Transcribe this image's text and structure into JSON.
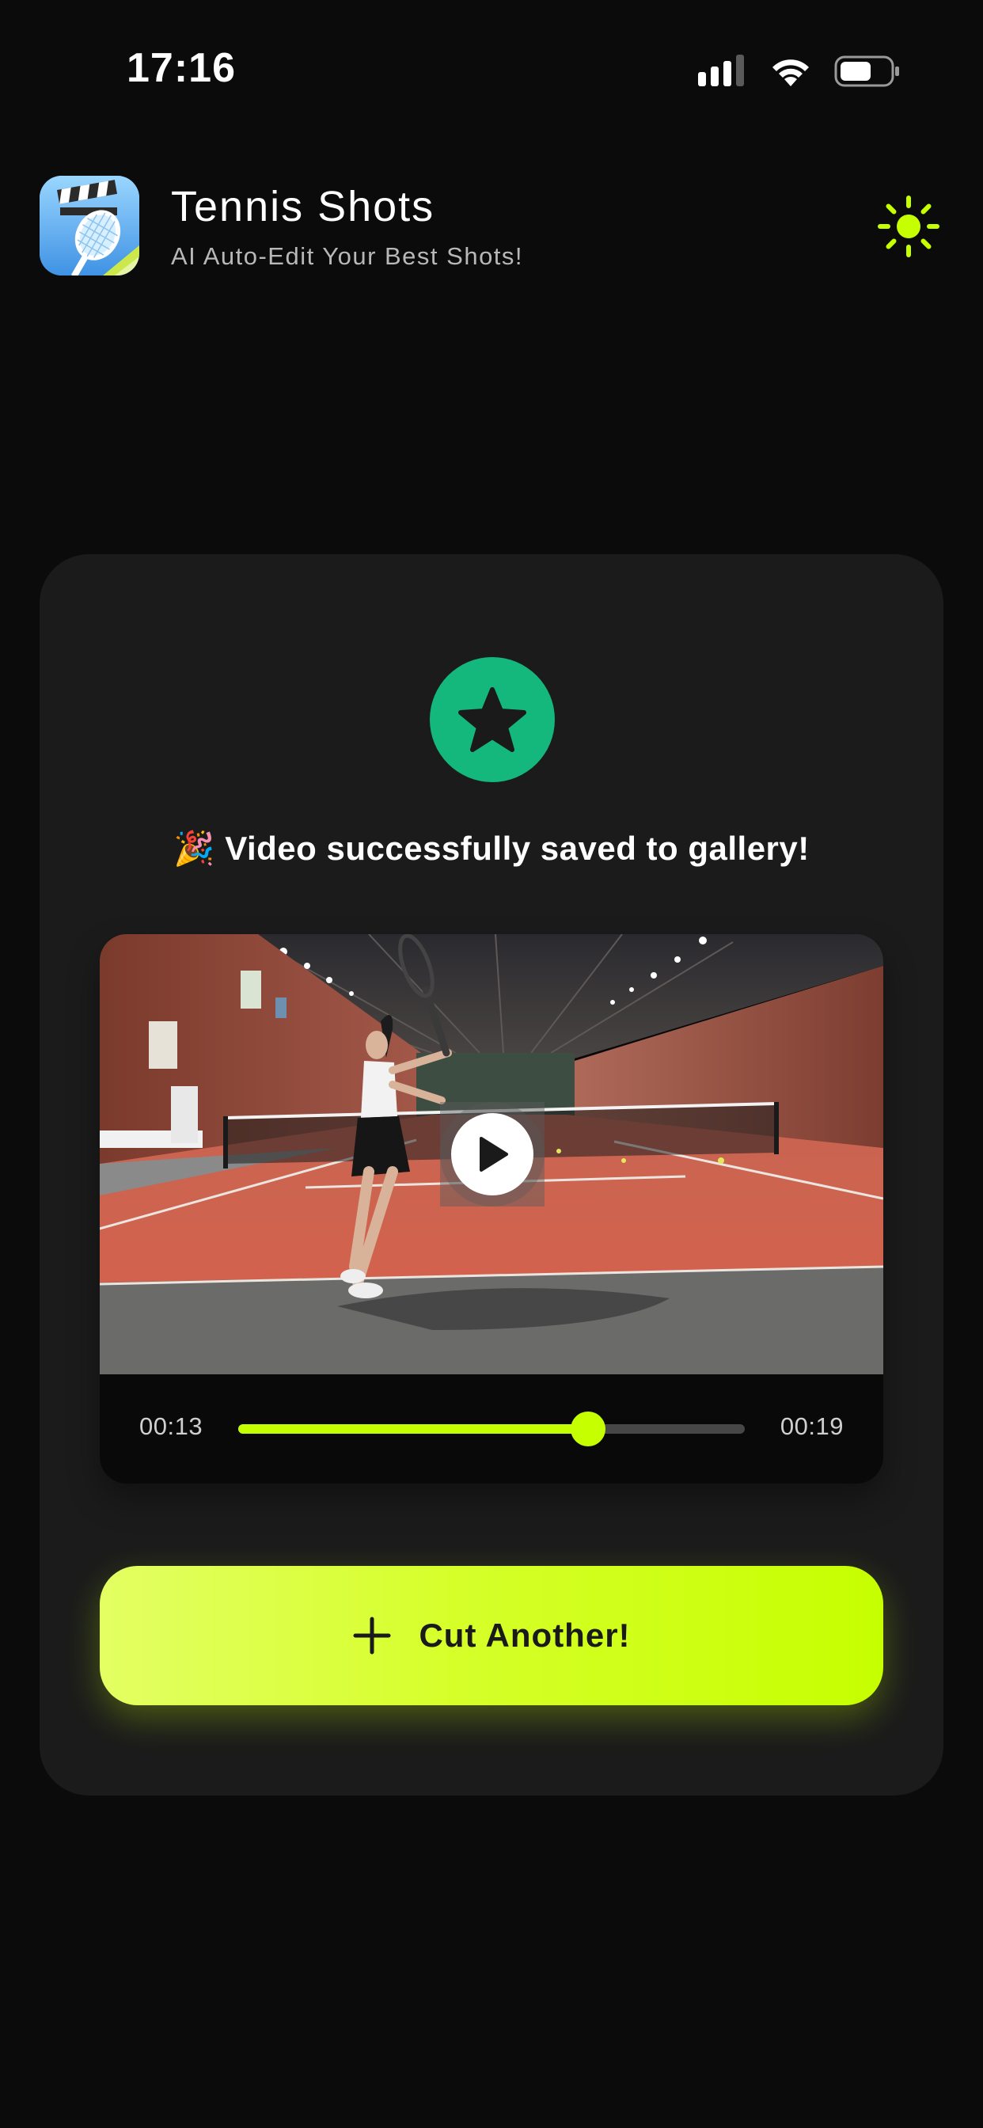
{
  "status_bar": {
    "time": "17:16",
    "icons": [
      "cellular-signal-icon",
      "wifi-icon",
      "battery-icon"
    ]
  },
  "header": {
    "title": "Tennis Shots",
    "subtitle": "AI Auto-Edit Your Best Shots!",
    "app_icon": "clapperboard-racket-icon",
    "theme_toggle_icon": "sun-icon"
  },
  "card": {
    "badge_icon": "star-icon",
    "success_message": "🎉 Video successfully saved to gallery!"
  },
  "video_player": {
    "thumbnail": "indoor-tennis-court-player-forehand",
    "play_icon": "play-icon",
    "current_time": "00:13",
    "total_time": "00:19",
    "progress": 0.69
  },
  "cta": {
    "icon": "plus-icon",
    "label": "Cut Another!"
  },
  "colors": {
    "background": "#0b0b0b",
    "card": "#1b1b1b",
    "accent": "#c6ff00",
    "success": "#14b87c"
  }
}
